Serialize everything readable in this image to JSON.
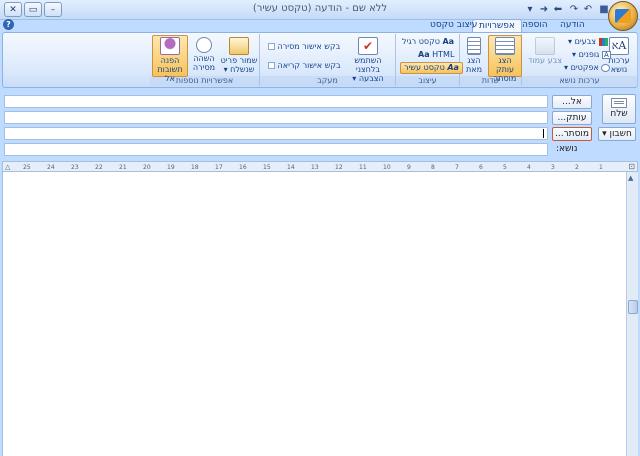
{
  "window": {
    "title": "ללא שם - הודעה (טקסט עשיר)"
  },
  "tabs": [
    {
      "label": "הודעה"
    },
    {
      "label": "הוספה"
    },
    {
      "label": "אפשרויות"
    },
    {
      "label": "עיצוב טקסט"
    }
  ],
  "ribbon": {
    "themes": {
      "label": "ערכות נושא",
      "themes_btn": "ערכות נושא",
      "colors": "צבעים",
      "fonts": "גופנים",
      "effects": "אפקטים",
      "page_color": "צבע עמוד"
    },
    "fields": {
      "label": "שדות",
      "show_bcc": "הצג עותק מוסתר",
      "show_from": "הצג מאת"
    },
    "format": {
      "label": "עיצוב",
      "plain": "טקסט רגיל",
      "html": "HTML",
      "rich": "טקסט עשיר"
    },
    "tracking": {
      "label": "מעקב",
      "use_voting": "השתמש בלחצני הצבעה",
      "delivery_receipt": "בקש אישור מסירה",
      "read_receipt": "בקש אישור קריאה"
    },
    "more": {
      "label": "אפשרויות נוספות",
      "save_sent": "שמור פריט שנשלח",
      "delay": "השהה מסירה",
      "direct_replies": "הפנה תשובות אל"
    }
  },
  "header": {
    "send": "שלח",
    "to": "אל...",
    "cc": "עותק...",
    "bcc": "מוסתר...",
    "account": "חשבון",
    "subject": "נושא:"
  },
  "ruler": {
    "ticks": [
      "25",
      "24",
      "23",
      "22",
      "21",
      "20",
      "19",
      "18",
      "17",
      "16",
      "15",
      "14",
      "13",
      "12",
      "11",
      "10",
      "9",
      "8",
      "7",
      "6",
      "5",
      "4",
      "3",
      "2",
      "1"
    ]
  }
}
